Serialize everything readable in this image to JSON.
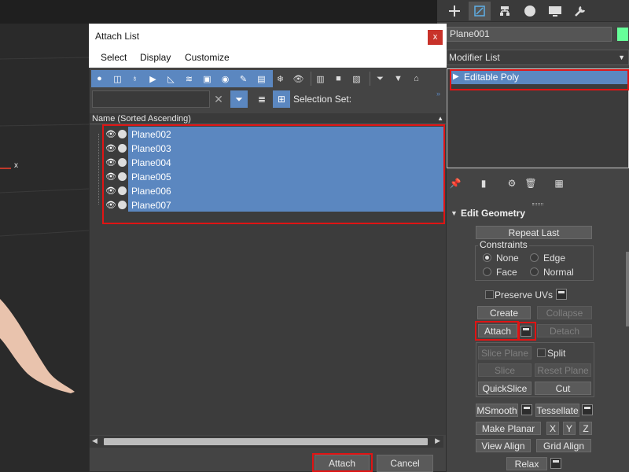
{
  "viewport": {
    "axis_label": "x"
  },
  "command_panel": {
    "tabs": [
      "create-icon",
      "modify-icon",
      "hierarchy-icon",
      "motion-icon",
      "display-icon",
      "utilities-icon"
    ],
    "object_name": "Plane001",
    "object_color": "#66ff99",
    "modifier_list_label": "Modifier List",
    "stack_item": "Editable Poly",
    "rollout_title": "Edit Geometry",
    "repeat_last": "Repeat Last",
    "constraints": {
      "label": "Constraints",
      "options": [
        "None",
        "Edge",
        "Face",
        "Normal"
      ],
      "selected": "None"
    },
    "preserve_uvs": "Preserve UVs",
    "create": "Create",
    "collapse": "Collapse",
    "attach": "Attach",
    "detach": "Detach",
    "slice_plane": "Slice Plane",
    "split": "Split",
    "slice": "Slice",
    "reset_plane": "Reset Plane",
    "quickslice": "QuickSlice",
    "cut": "Cut",
    "msmooth": "MSmooth",
    "tessellate": "Tessellate",
    "make_planar": "Make Planar",
    "x": "X",
    "y": "Y",
    "z": "Z",
    "view_align": "View Align",
    "grid_align": "Grid Align",
    "relax": "Relax"
  },
  "dialog": {
    "title": "Attach List",
    "close": "x",
    "menu": [
      "Select",
      "Display",
      "Customize"
    ],
    "selection_set_label": "Selection Set:",
    "search_value": "",
    "column_header": "Name (Sorted Ascending)",
    "items": [
      "Plane002",
      "Plane003",
      "Plane004",
      "Plane005",
      "Plane006",
      "Plane007"
    ],
    "attach_button": "Attach",
    "cancel_button": "Cancel"
  }
}
